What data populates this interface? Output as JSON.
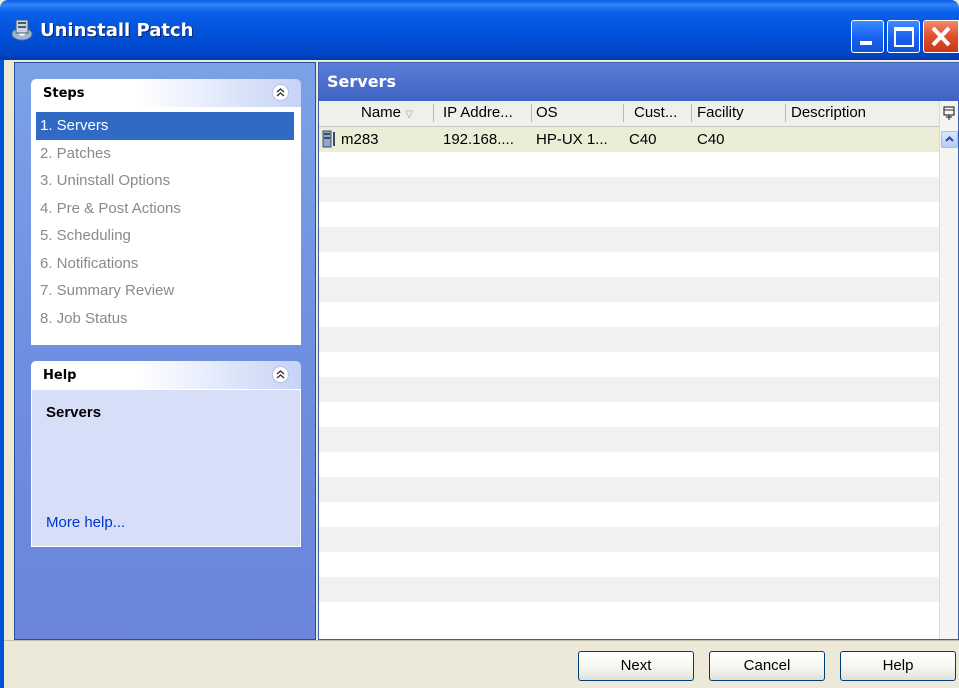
{
  "window": {
    "title": "Uninstall Patch",
    "icon": "server-cd-icon"
  },
  "steps": {
    "title": "Steps",
    "items": [
      {
        "label": "1. Servers",
        "active": true
      },
      {
        "label": "2. Patches",
        "active": false
      },
      {
        "label": "3. Uninstall Options",
        "active": false
      },
      {
        "label": "4. Pre & Post Actions",
        "active": false
      },
      {
        "label": "5. Scheduling",
        "active": false
      },
      {
        "label": "6. Notifications",
        "active": false
      },
      {
        "label": "7. Summary Review",
        "active": false
      },
      {
        "label": "8. Job Status",
        "active": false
      }
    ]
  },
  "help": {
    "title": "Help",
    "topic": "Servers",
    "more_link": "More help..."
  },
  "servers_panel": {
    "title": "Servers",
    "columns": [
      "Name",
      "IP Addre...",
      "OS",
      "Cust...",
      "Facility",
      "Description"
    ],
    "sort_column": "Name",
    "rows": [
      {
        "name": "m283",
        "ip": "192.168....",
        "os": "HP-UX 1...",
        "customer": "C40",
        "facility": "C40",
        "description": ""
      }
    ]
  },
  "buttons": {
    "next": "Next",
    "cancel": "Cancel",
    "help": "Help"
  },
  "colors": {
    "titlebar": "#0050d8",
    "left_panel": "#7ba2e7",
    "selection": "#316ac5",
    "link": "#0033cc"
  }
}
